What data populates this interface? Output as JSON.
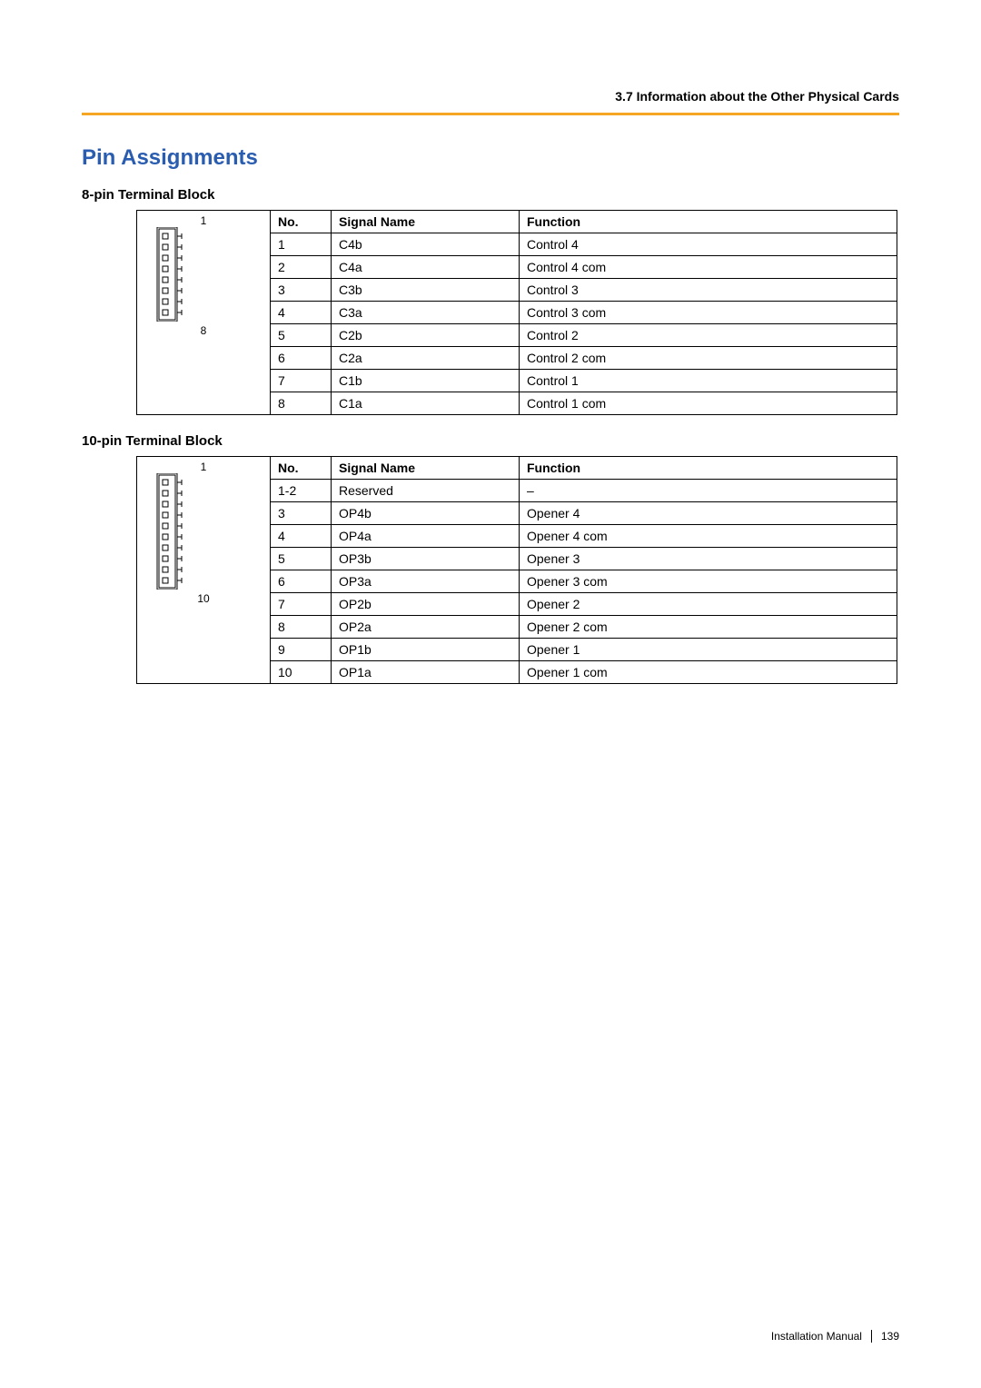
{
  "header": {
    "section_label": "3.7 Information about the Other Physical Cards"
  },
  "title": "Pin Assignments",
  "tables": {
    "t8": {
      "heading": "8-pin Terminal Block",
      "diagram": {
        "top_label": "1",
        "bottom_label": "8",
        "pin_count": 8
      },
      "columns": {
        "no": "No.",
        "signal": "Signal Name",
        "func": "Function"
      },
      "rows": [
        {
          "no": "1",
          "signal": "C4b",
          "func": "Control 4"
        },
        {
          "no": "2",
          "signal": "C4a",
          "func": "Control 4 com"
        },
        {
          "no": "3",
          "signal": "C3b",
          "func": "Control 3"
        },
        {
          "no": "4",
          "signal": "C3a",
          "func": "Control 3 com"
        },
        {
          "no": "5",
          "signal": "C2b",
          "func": "Control 2"
        },
        {
          "no": "6",
          "signal": "C2a",
          "func": "Control 2 com"
        },
        {
          "no": "7",
          "signal": "C1b",
          "func": "Control 1"
        },
        {
          "no": "8",
          "signal": "C1a",
          "func": "Control 1 com"
        }
      ]
    },
    "t10": {
      "heading": "10-pin Terminal Block",
      "diagram": {
        "top_label": "1",
        "bottom_label": "10",
        "pin_count": 10
      },
      "columns": {
        "no": "No.",
        "signal": "Signal Name",
        "func": "Function"
      },
      "rows": [
        {
          "no": "1-2",
          "signal": "Reserved",
          "func": "–"
        },
        {
          "no": "3",
          "signal": "OP4b",
          "func": "Opener 4"
        },
        {
          "no": "4",
          "signal": "OP4a",
          "func": "Opener 4 com"
        },
        {
          "no": "5",
          "signal": "OP3b",
          "func": "Opener 3"
        },
        {
          "no": "6",
          "signal": "OP3a",
          "func": "Opener 3 com"
        },
        {
          "no": "7",
          "signal": "OP2b",
          "func": "Opener 2"
        },
        {
          "no": "8",
          "signal": "OP2a",
          "func": "Opener 2 com"
        },
        {
          "no": "9",
          "signal": "OP1b",
          "func": "Opener 1"
        },
        {
          "no": "10",
          "signal": "OP1a",
          "func": "Opener 1 com"
        }
      ]
    }
  },
  "footer": {
    "manual_label": "Installation Manual",
    "page_number": "139"
  }
}
